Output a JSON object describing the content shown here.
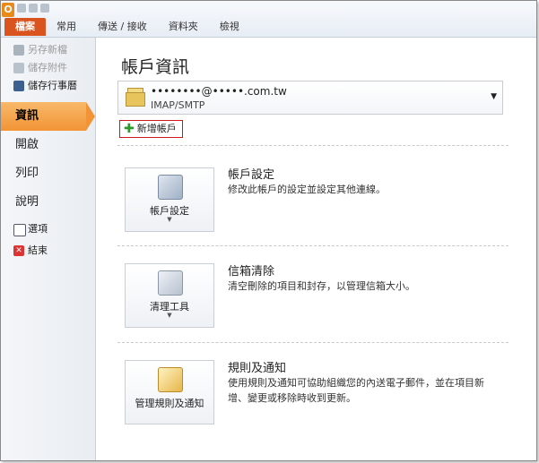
{
  "ribbon": {
    "tabs": [
      "檔案",
      "常用",
      "傳送 / 接收",
      "資料夾",
      "檢視"
    ]
  },
  "nav": {
    "items": [
      {
        "label": "另存新檔",
        "icon": "save-as-icon",
        "enabled": false
      },
      {
        "label": "儲存附件",
        "icon": "save-attachment-icon",
        "enabled": false
      },
      {
        "label": "儲存行事曆",
        "icon": "calendar-icon",
        "enabled": true
      }
    ],
    "info": "資訊",
    "open": "開啟",
    "print": "列印",
    "help": "說明",
    "options": "選項",
    "exit": "結束"
  },
  "main": {
    "title": "帳戶資訊",
    "account": {
      "email": "••••••••@•••••.com.tw",
      "type": "IMAP/SMTP"
    },
    "add_account": "新增帳戶",
    "sections": [
      {
        "button": "帳戶設定",
        "title": "帳戶設定",
        "desc": "修改此帳戶的設定並設定其他連線。"
      },
      {
        "button": "清理工具",
        "title": "信箱清除",
        "desc": "清空刪除的項目和封存，以管理信箱大小。"
      },
      {
        "button": "管理規則及通知",
        "title": "規則及通知",
        "desc": "使用規則及通知可協助組織您的內送電子郵件，並在項目新增、變更或移除時收到更新。"
      }
    ]
  }
}
